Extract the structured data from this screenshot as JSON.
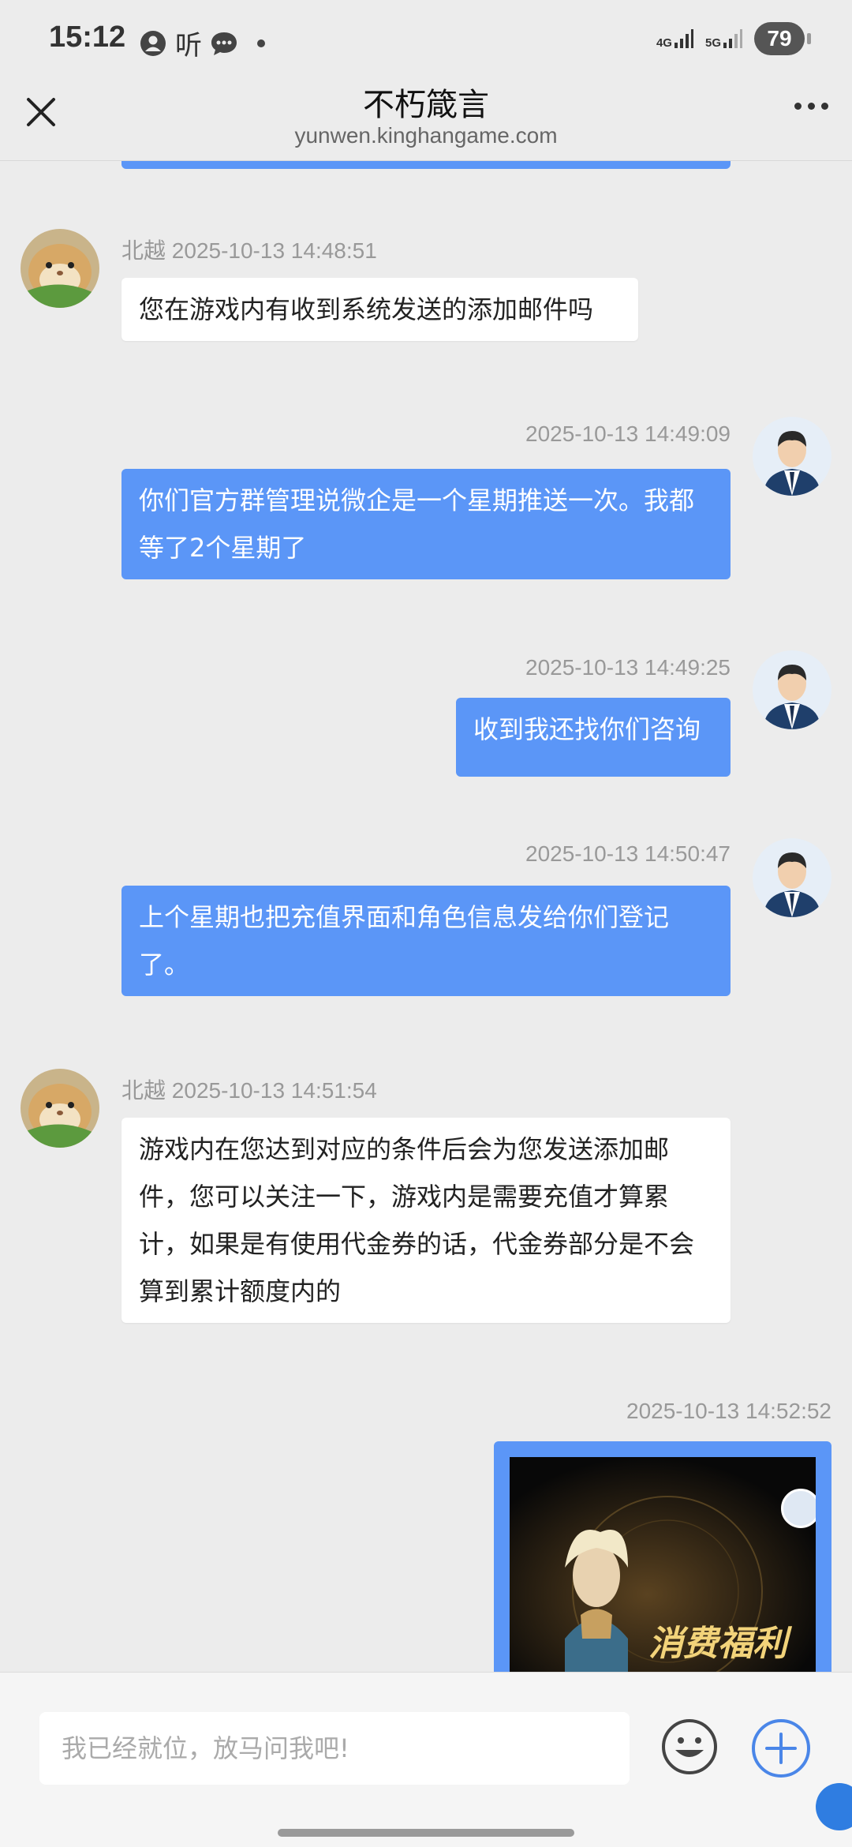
{
  "status_bar": {
    "time": "15:12",
    "ting": "听",
    "network_1": "4G",
    "network_2": "5G",
    "battery": "79"
  },
  "header": {
    "title": "不朽箴言",
    "url": "yunwen.kinghangame.com"
  },
  "messages": [
    {
      "sender": "北越",
      "time": "2025-10-13 14:48:51",
      "text": "您在游戏内有收到系统发送的添加邮件吗",
      "direction": "in"
    },
    {
      "time": "2025-10-13 14:49:09",
      "text": "你们官方群管理说微企是一个星期推送一次。我都等了2个星期了",
      "direction": "out"
    },
    {
      "time": "2025-10-13 14:49:25",
      "text": "收到我还找你们咨询",
      "direction": "out"
    },
    {
      "time": "2025-10-13 14:50:47",
      "text": "上个星期也把充值界面和角色信息发给你们登记了。",
      "direction": "out"
    },
    {
      "sender": "北越",
      "time": "2025-10-13 14:51:54",
      "text": "游戏内在您达到对应的条件后会为您发送添加邮件，您可以关注一下，游戏内是需要充值才算累计，如果是有使用代金券的话，代金券部分是不会算到累计额度内的",
      "direction": "in"
    },
    {
      "time": "2025-10-13 14:52:52",
      "image_caption": "消费福利",
      "direction": "out"
    }
  ],
  "input": {
    "placeholder": "我已经就位，放马问我吧!"
  },
  "colors": {
    "outgoing_bubble": "#5b96f7",
    "incoming_bubble": "#ffffff",
    "background": "#ececec",
    "accent_plus": "#4a86e8"
  }
}
